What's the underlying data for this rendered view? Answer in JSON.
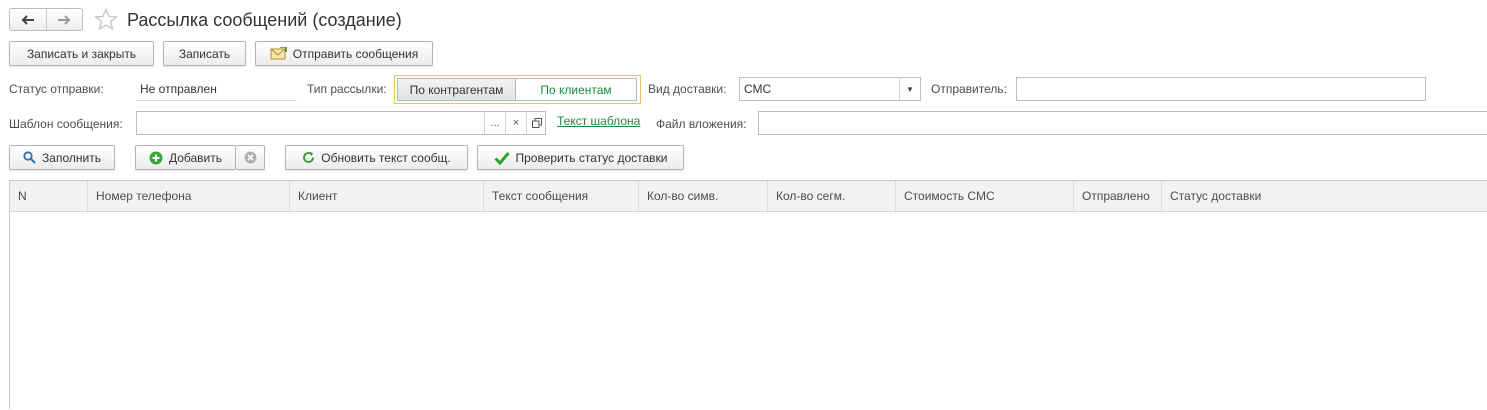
{
  "window": {
    "title": "Рассылка сообщений (создание)"
  },
  "toolbar": {
    "save_close_label": "Записать и закрыть",
    "save_label": "Записать",
    "send_label": "Отправить сообщения"
  },
  "form": {
    "status_label": "Статус отправки:",
    "status_value": "Не отправлен",
    "mailing_type_label": "Тип рассылки:",
    "mailing_type_options": [
      "По контрагентам",
      "По клиентам"
    ],
    "mailing_type_selected": "По клиентам",
    "delivery_label": "Вид доставки:",
    "delivery_value": "СМС",
    "sender_label": "Отправитель:",
    "sender_value": "",
    "template_label": "Шаблон сообщения:",
    "template_value": "",
    "template_select_glyph": "...",
    "template_clear_glyph": "×",
    "template_text_link": "Текст шаблона",
    "attachment_label": "Файл вложения:",
    "attachment_value": ""
  },
  "table_toolbar": {
    "fill_label": "Заполнить",
    "add_label": "Добавить",
    "refresh_label": "Обновить текст сообщ.",
    "check_label": "Проверить статус доставки"
  },
  "table": {
    "columns": [
      "N",
      "Номер телефона",
      "Клиент",
      "Текст сообщения",
      "Кол-во симв.",
      "Кол-во сегм.",
      "Стоимость СМС",
      "Отправлено",
      "Статус доставки"
    ],
    "rows": []
  },
  "colors": {
    "accent_green": "#1a8c3a",
    "radio_border": "#e7c75a",
    "header_bg": "#f2f2f2"
  }
}
